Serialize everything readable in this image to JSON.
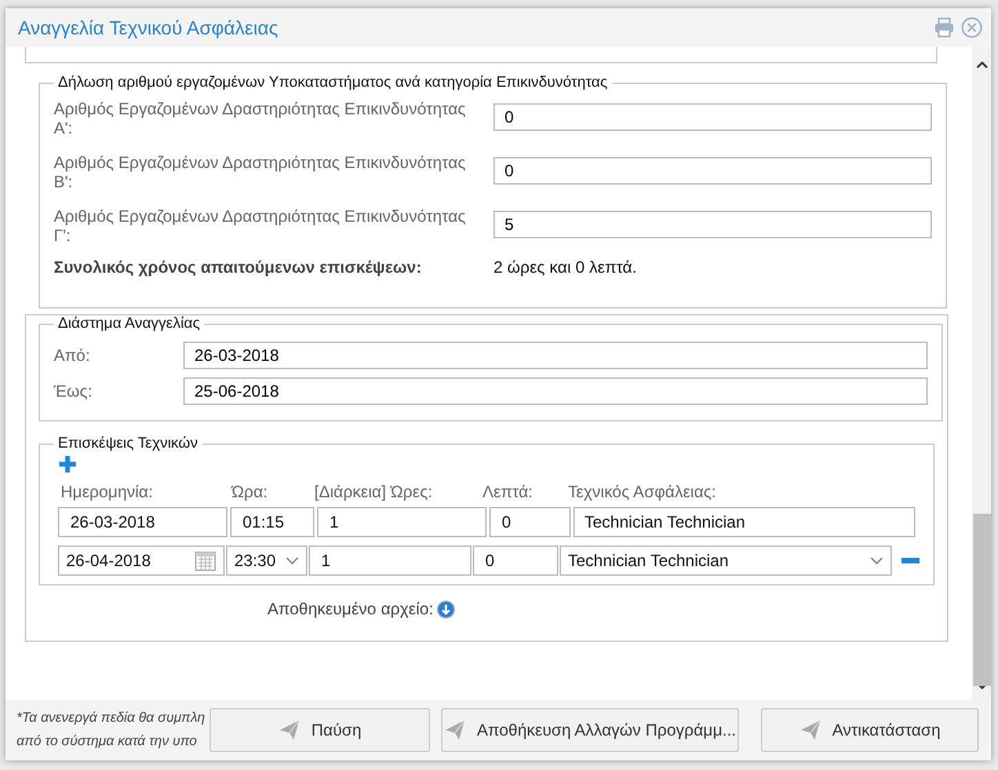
{
  "window": {
    "title": "Αναγγελία Τεχνικού Ασφάλειας"
  },
  "employees": {
    "legend": "Δήλωση αριθμού εργαζομένων Υποκαταστήματος ανά κατηγορία Επικινδυνότητας",
    "fields": [
      {
        "label": "Αριθμός Εργαζομένων Δραστηριότητας Επικινδυνότητας Α':",
        "value": "0"
      },
      {
        "label": "Αριθμός Εργαζομένων Δραστηριότητας Επικινδυνότητας Β':",
        "value": "0"
      },
      {
        "label": "Αριθμός Εργαζομένων Δραστηριότητας Επικινδυνότητας Γ':",
        "value": "5"
      }
    ],
    "total_label": "Συνολικός χρόνος απαιτούμενων επισκέψεων:",
    "total_value": "2 ώρες και 0 λεπτά."
  },
  "period": {
    "legend": "Διάστημα Αναγγελίας",
    "fields": [
      {
        "label": "Από:",
        "value": "26-03-2018"
      },
      {
        "label": "Έως:",
        "value": "25-06-2018"
      }
    ]
  },
  "visits": {
    "legend": "Επισκέψεις Τεχνικών",
    "columns": [
      "Ημερομηνία:",
      "Ώρα:",
      "[Διάρκεια] Ώρες:",
      "Λεπτά:",
      "Τεχνικός Ασφάλειας:"
    ],
    "rows": [
      {
        "kind": "plain",
        "date": "26-03-2018",
        "time": "01:15",
        "hours": "1",
        "minutes": "0",
        "technician": "Technician Technician"
      },
      {
        "kind": "edit",
        "date": "26-04-2018",
        "time": "23:30",
        "hours": "1",
        "minutes": "0",
        "technician": "Technician Technician"
      }
    ]
  },
  "saved_file_label": "Αποθηκευμένο αρχείο:",
  "footer": {
    "note": [
      "*Τα ανενεργά πεδία θα συμπλη",
      "από το σύστημα κατά την υπο"
    ],
    "buttons": [
      "Παύση",
      "Αποθήκευση Αλλαγών Προγράμμ...",
      "Αντικατάσταση"
    ]
  }
}
